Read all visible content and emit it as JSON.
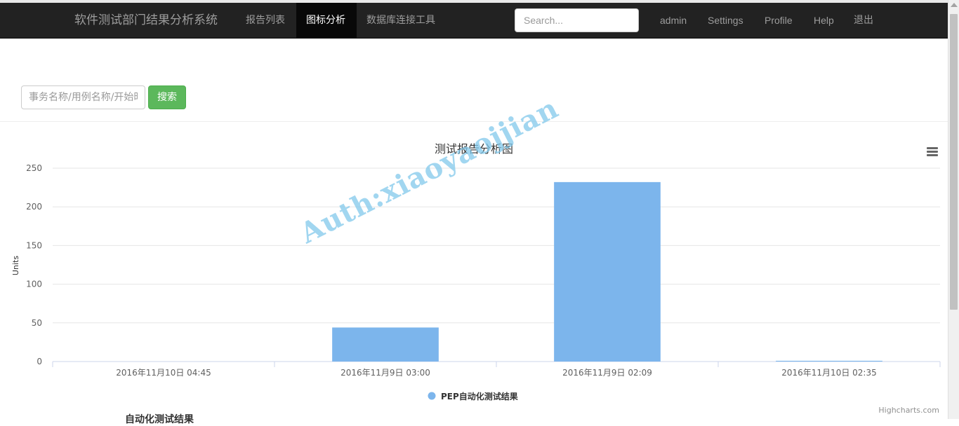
{
  "nav": {
    "brand": "软件测试部门结果分析系统",
    "items": [
      {
        "label": "报告列表",
        "active": false
      },
      {
        "label": "图标分析",
        "active": true
      },
      {
        "label": "数据库连接工具",
        "active": false
      }
    ],
    "search_placeholder": "Search...",
    "right_items": [
      "admin",
      "Settings",
      "Profile",
      "Help",
      "退出"
    ]
  },
  "filter": {
    "placeholder": "事务名称/用例名称/开始时间",
    "button_label": "搜索"
  },
  "watermark": "Auth:xiaoyaojjian",
  "below_text": "自动化测试结果",
  "chart_data": {
    "type": "bar",
    "title": "测试报告分析图",
    "ylabel": "Units",
    "xlabel": "",
    "ylim": [
      0,
      250
    ],
    "yticks": [
      0,
      50,
      100,
      150,
      200,
      250
    ],
    "categories": [
      "2016年11月10日 04:45",
      "2016年11月9日 03:00",
      "2016年11月9日 02:09",
      "2016年11月10日 02:35"
    ],
    "series": [
      {
        "name": "PEP自动化测试结果",
        "values": [
          0,
          44,
          232,
          1
        ],
        "color": "#7cb5ec"
      }
    ],
    "legend_position": "bottom-center",
    "grid": true,
    "credits": "Highcharts.com"
  }
}
